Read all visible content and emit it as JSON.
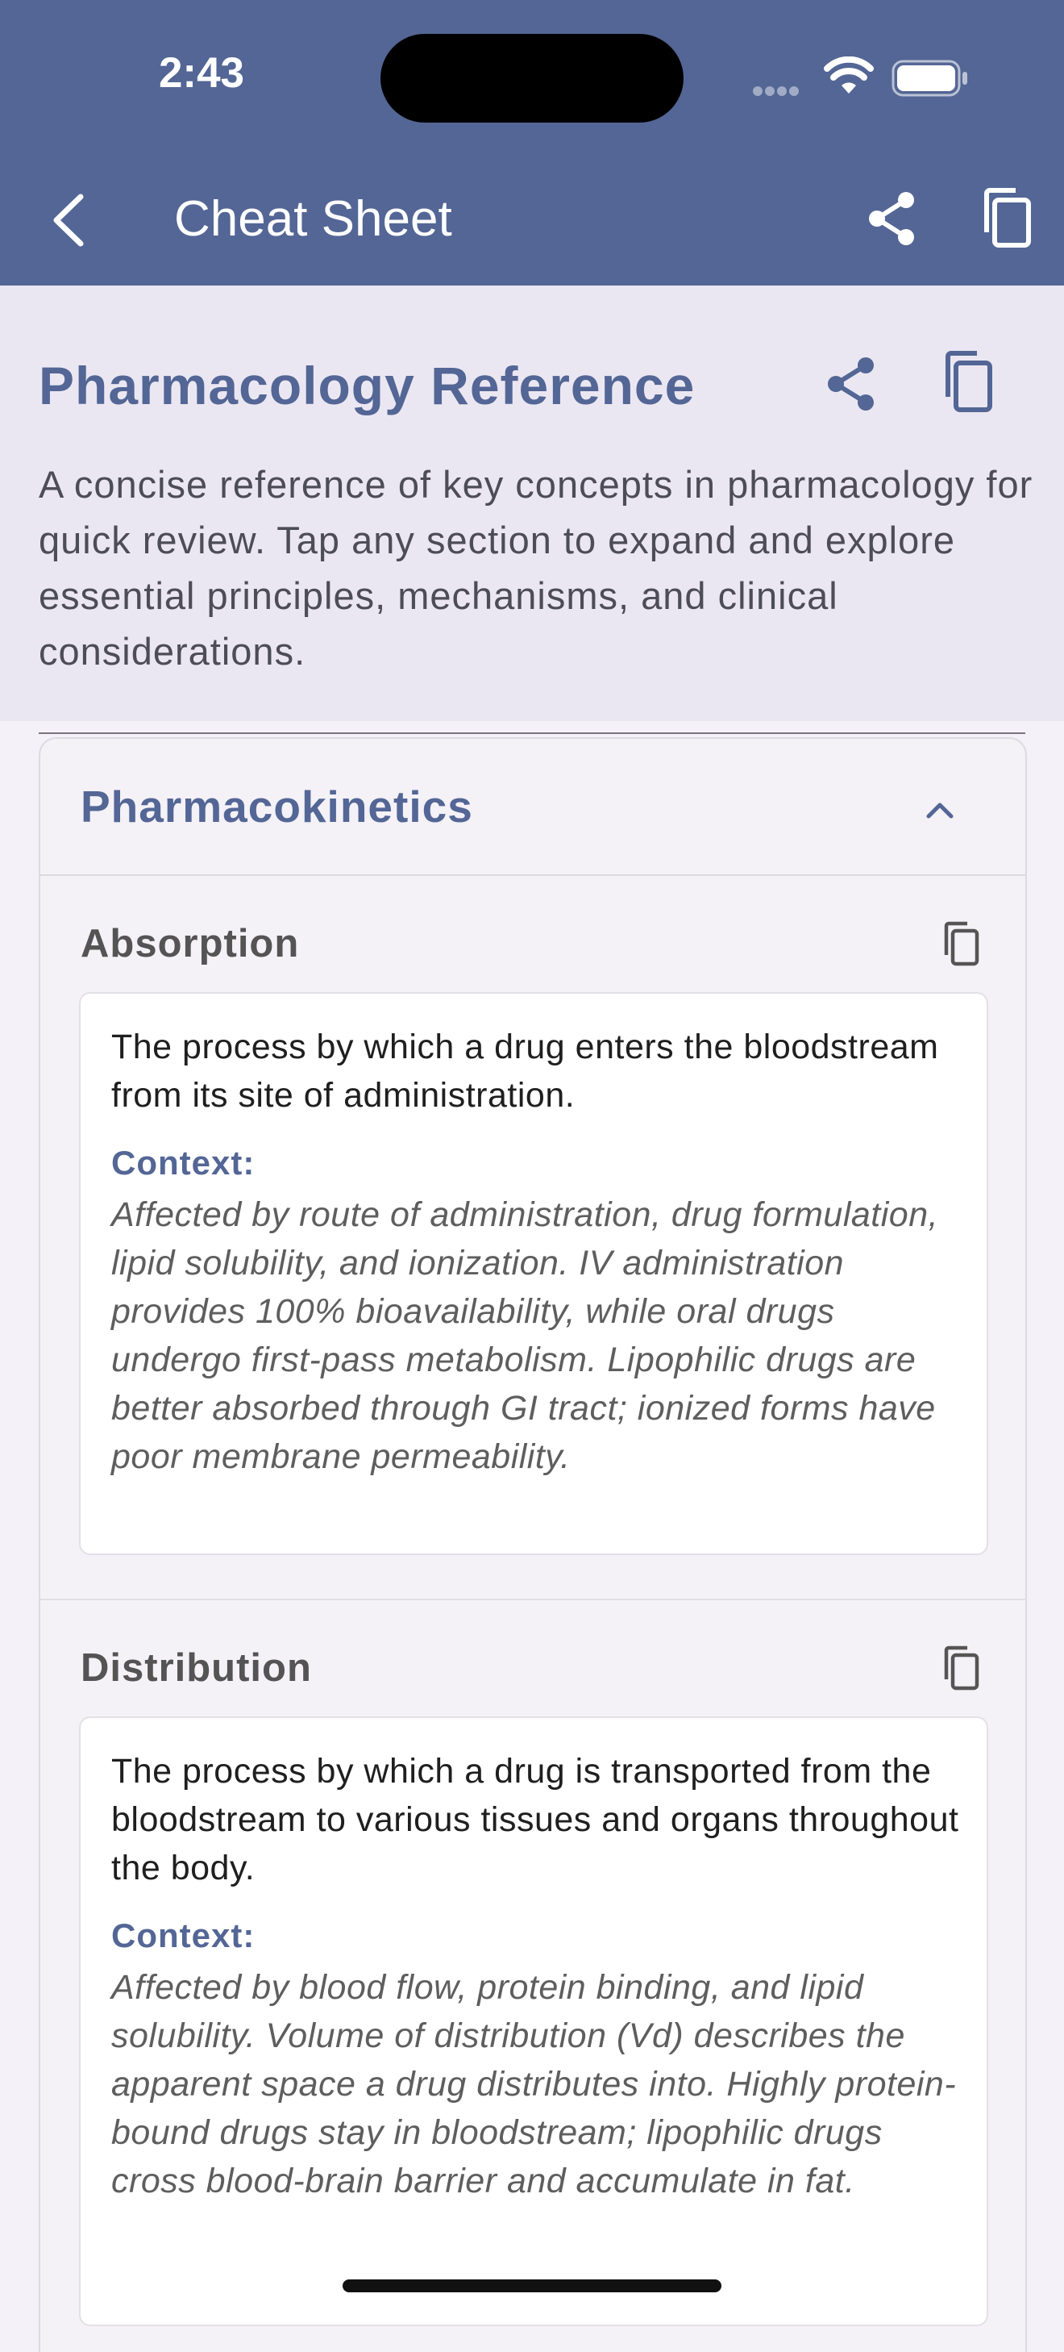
{
  "status_bar": {
    "time": "2:43"
  },
  "app_bar": {
    "title": "Cheat Sheet",
    "icons": [
      "back-icon",
      "share-icon",
      "copy-icon"
    ]
  },
  "header": {
    "title": "Pharmacology Reference",
    "description": "A concise reference of key concepts in pharmacology for quick review. Tap any section to expand and explore essential principles, mechanisms, and clinical considerations."
  },
  "section": {
    "title": "Pharmacokinetics",
    "expanded": true,
    "entries": [
      {
        "title": "Absorption",
        "definition": "The process by which a drug enters the bloodstream from its site of administration.",
        "context_label": "Context:",
        "context": "Affected by route of administration, drug formulation, lipid solubility, and ionization. IV administration provides 100% bioavailability, while oral drugs undergo first-pass metabolism. Lipophilic drugs are better absorbed through GI tract; ionized forms have poor membrane permeability."
      },
      {
        "title": "Distribution",
        "definition": "The process by which a drug is transported from the bloodstream to various tissues and organs throughout the body.",
        "context_label": "Context:",
        "context": "Affected by blood flow, protein binding, and lipid solubility. Volume of distribution (Vd) describes the apparent space a drug distributes into. Highly protein-bound drugs stay in bloodstream; lipophilic drugs cross blood-brain barrier and accumulate in fat."
      }
    ]
  },
  "colors": {
    "primary": "#536695",
    "header_bg": "#ebe7f2",
    "page_bg": "#f5f1f8"
  }
}
